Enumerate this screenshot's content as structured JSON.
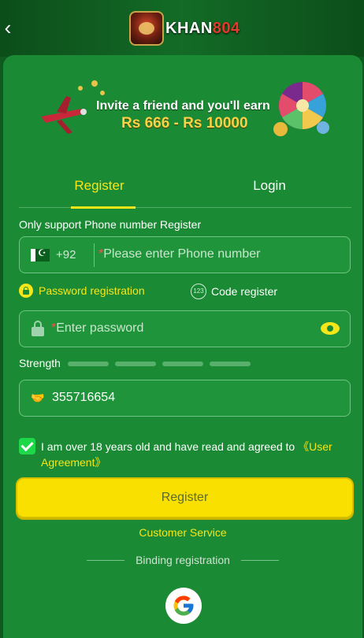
{
  "header": {
    "back_glyph": "‹",
    "brand_text_a": "KHAN",
    "brand_text_b": "804"
  },
  "banner": {
    "line1": "Invite a friend and you'll earn",
    "line2": "Rs 666 - Rs 10000"
  },
  "tabs": [
    {
      "label": "Register",
      "active": true
    },
    {
      "label": "Login",
      "active": false
    }
  ],
  "form": {
    "hint": "Only support Phone number Register",
    "phone": {
      "country_code": "+92",
      "required_mark": "*",
      "placeholder": "Please enter Phone number"
    },
    "modes": {
      "password": "Password registration",
      "code_icon": "123",
      "code": "Code register"
    },
    "password": {
      "required_mark": "*",
      "placeholder": "Enter password"
    },
    "strength_label": "Strength",
    "invite_value": "355716654",
    "agreement": {
      "text": "I am over 18 years old and have read and agreed to ",
      "link": "《User Agreement》",
      "checked": true
    }
  },
  "actions": {
    "register_button": "Register",
    "customer_service": "Customer Service",
    "binding_registration": "Binding registration"
  },
  "colors": {
    "accent": "#f5e61a",
    "background": "#1b8a34",
    "button": "#f9e000"
  },
  "icons": [
    "back-arrow-icon",
    "brand-logo",
    "pakistan-flag-icon",
    "lock-icon",
    "code-123-icon",
    "eye-icon",
    "handshake-icon",
    "checkbox-checked-icon",
    "google-icon"
  ]
}
